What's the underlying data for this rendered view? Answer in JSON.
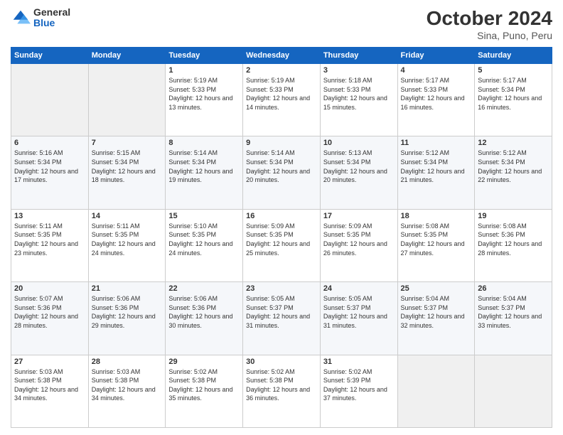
{
  "header": {
    "logo_general": "General",
    "logo_blue": "Blue",
    "month_title": "October 2024",
    "subtitle": "Sina, Puno, Peru"
  },
  "weekdays": [
    "Sunday",
    "Monday",
    "Tuesday",
    "Wednesday",
    "Thursday",
    "Friday",
    "Saturday"
  ],
  "weeks": [
    [
      {
        "num": "",
        "empty": true
      },
      {
        "num": "",
        "empty": true
      },
      {
        "num": "1",
        "sunrise": "Sunrise: 5:19 AM",
        "sunset": "Sunset: 5:33 PM",
        "daylight": "Daylight: 12 hours and 13 minutes."
      },
      {
        "num": "2",
        "sunrise": "Sunrise: 5:19 AM",
        "sunset": "Sunset: 5:33 PM",
        "daylight": "Daylight: 12 hours and 14 minutes."
      },
      {
        "num": "3",
        "sunrise": "Sunrise: 5:18 AM",
        "sunset": "Sunset: 5:33 PM",
        "daylight": "Daylight: 12 hours and 15 minutes."
      },
      {
        "num": "4",
        "sunrise": "Sunrise: 5:17 AM",
        "sunset": "Sunset: 5:33 PM",
        "daylight": "Daylight: 12 hours and 16 minutes."
      },
      {
        "num": "5",
        "sunrise": "Sunrise: 5:17 AM",
        "sunset": "Sunset: 5:34 PM",
        "daylight": "Daylight: 12 hours and 16 minutes."
      }
    ],
    [
      {
        "num": "6",
        "sunrise": "Sunrise: 5:16 AM",
        "sunset": "Sunset: 5:34 PM",
        "daylight": "Daylight: 12 hours and 17 minutes."
      },
      {
        "num": "7",
        "sunrise": "Sunrise: 5:15 AM",
        "sunset": "Sunset: 5:34 PM",
        "daylight": "Daylight: 12 hours and 18 minutes."
      },
      {
        "num": "8",
        "sunrise": "Sunrise: 5:14 AM",
        "sunset": "Sunset: 5:34 PM",
        "daylight": "Daylight: 12 hours and 19 minutes."
      },
      {
        "num": "9",
        "sunrise": "Sunrise: 5:14 AM",
        "sunset": "Sunset: 5:34 PM",
        "daylight": "Daylight: 12 hours and 20 minutes."
      },
      {
        "num": "10",
        "sunrise": "Sunrise: 5:13 AM",
        "sunset": "Sunset: 5:34 PM",
        "daylight": "Daylight: 12 hours and 20 minutes."
      },
      {
        "num": "11",
        "sunrise": "Sunrise: 5:12 AM",
        "sunset": "Sunset: 5:34 PM",
        "daylight": "Daylight: 12 hours and 21 minutes."
      },
      {
        "num": "12",
        "sunrise": "Sunrise: 5:12 AM",
        "sunset": "Sunset: 5:34 PM",
        "daylight": "Daylight: 12 hours and 22 minutes."
      }
    ],
    [
      {
        "num": "13",
        "sunrise": "Sunrise: 5:11 AM",
        "sunset": "Sunset: 5:35 PM",
        "daylight": "Daylight: 12 hours and 23 minutes."
      },
      {
        "num": "14",
        "sunrise": "Sunrise: 5:11 AM",
        "sunset": "Sunset: 5:35 PM",
        "daylight": "Daylight: 12 hours and 24 minutes."
      },
      {
        "num": "15",
        "sunrise": "Sunrise: 5:10 AM",
        "sunset": "Sunset: 5:35 PM",
        "daylight": "Daylight: 12 hours and 24 minutes."
      },
      {
        "num": "16",
        "sunrise": "Sunrise: 5:09 AM",
        "sunset": "Sunset: 5:35 PM",
        "daylight": "Daylight: 12 hours and 25 minutes."
      },
      {
        "num": "17",
        "sunrise": "Sunrise: 5:09 AM",
        "sunset": "Sunset: 5:35 PM",
        "daylight": "Daylight: 12 hours and 26 minutes."
      },
      {
        "num": "18",
        "sunrise": "Sunrise: 5:08 AM",
        "sunset": "Sunset: 5:35 PM",
        "daylight": "Daylight: 12 hours and 27 minutes."
      },
      {
        "num": "19",
        "sunrise": "Sunrise: 5:08 AM",
        "sunset": "Sunset: 5:36 PM",
        "daylight": "Daylight: 12 hours and 28 minutes."
      }
    ],
    [
      {
        "num": "20",
        "sunrise": "Sunrise: 5:07 AM",
        "sunset": "Sunset: 5:36 PM",
        "daylight": "Daylight: 12 hours and 28 minutes."
      },
      {
        "num": "21",
        "sunrise": "Sunrise: 5:06 AM",
        "sunset": "Sunset: 5:36 PM",
        "daylight": "Daylight: 12 hours and 29 minutes."
      },
      {
        "num": "22",
        "sunrise": "Sunrise: 5:06 AM",
        "sunset": "Sunset: 5:36 PM",
        "daylight": "Daylight: 12 hours and 30 minutes."
      },
      {
        "num": "23",
        "sunrise": "Sunrise: 5:05 AM",
        "sunset": "Sunset: 5:37 PM",
        "daylight": "Daylight: 12 hours and 31 minutes."
      },
      {
        "num": "24",
        "sunrise": "Sunrise: 5:05 AM",
        "sunset": "Sunset: 5:37 PM",
        "daylight": "Daylight: 12 hours and 31 minutes."
      },
      {
        "num": "25",
        "sunrise": "Sunrise: 5:04 AM",
        "sunset": "Sunset: 5:37 PM",
        "daylight": "Daylight: 12 hours and 32 minutes."
      },
      {
        "num": "26",
        "sunrise": "Sunrise: 5:04 AM",
        "sunset": "Sunset: 5:37 PM",
        "daylight": "Daylight: 12 hours and 33 minutes."
      }
    ],
    [
      {
        "num": "27",
        "sunrise": "Sunrise: 5:03 AM",
        "sunset": "Sunset: 5:38 PM",
        "daylight": "Daylight: 12 hours and 34 minutes."
      },
      {
        "num": "28",
        "sunrise": "Sunrise: 5:03 AM",
        "sunset": "Sunset: 5:38 PM",
        "daylight": "Daylight: 12 hours and 34 minutes."
      },
      {
        "num": "29",
        "sunrise": "Sunrise: 5:02 AM",
        "sunset": "Sunset: 5:38 PM",
        "daylight": "Daylight: 12 hours and 35 minutes."
      },
      {
        "num": "30",
        "sunrise": "Sunrise: 5:02 AM",
        "sunset": "Sunset: 5:38 PM",
        "daylight": "Daylight: 12 hours and 36 minutes."
      },
      {
        "num": "31",
        "sunrise": "Sunrise: 5:02 AM",
        "sunset": "Sunset: 5:39 PM",
        "daylight": "Daylight: 12 hours and 37 minutes."
      },
      {
        "num": "",
        "empty": true
      },
      {
        "num": "",
        "empty": true
      }
    ]
  ]
}
